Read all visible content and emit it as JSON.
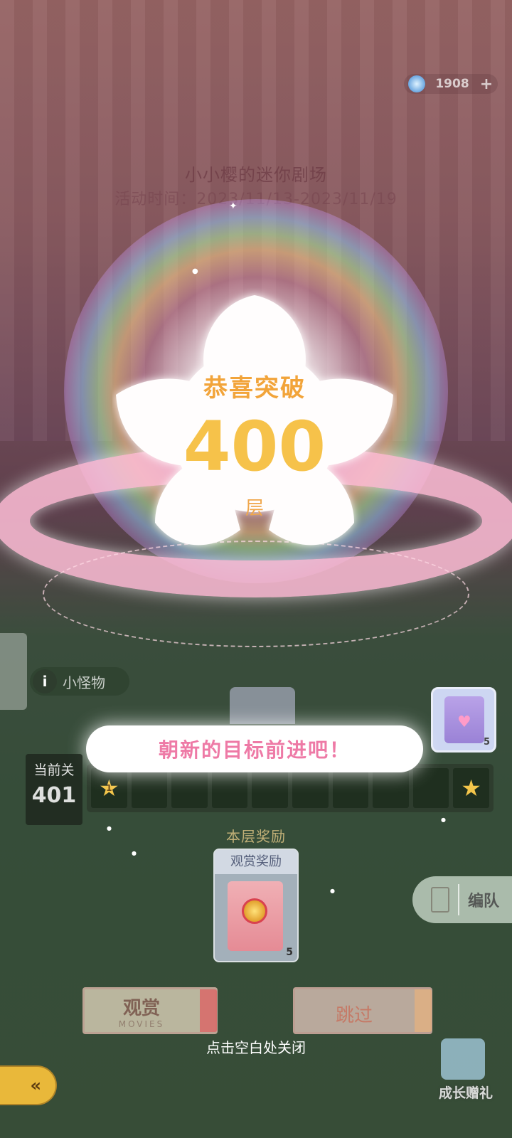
{
  "top_bar": {
    "currency_value": "1908",
    "currency_icon": "crystal-gem-icon",
    "add_icon": "plus-icon"
  },
  "event": {
    "title": "小小樱的迷你剧场",
    "time": "活动时间：2023/11/13-2023/11/19"
  },
  "popup": {
    "congrats": "恭喜突破",
    "floor": "400",
    "unit": "层",
    "goal": "朝新的目标前进吧！",
    "close_hint": "点击空白处关闭"
  },
  "monster": {
    "icon_label": "i",
    "label": "小怪物"
  },
  "level": {
    "label": "当前关",
    "value": "401"
  },
  "progress": {
    "first_star_number": "1",
    "next_reward_count": "5"
  },
  "reward_section": {
    "title": "本层奖励",
    "card_title": "观赏奖励",
    "card_count": "5"
  },
  "formation": {
    "label": "编队"
  },
  "buttons": {
    "watch_label": "观赏",
    "watch_sub": "MOVIES",
    "skip_label": "跳过",
    "back_icon": "back-arrow-icon"
  },
  "growth_gift": {
    "label": "成长赠礼"
  },
  "colors": {
    "accent_gold": "#f6c24a",
    "goal_pink": "#ee7aa6",
    "back_button": "#e9b83a"
  }
}
